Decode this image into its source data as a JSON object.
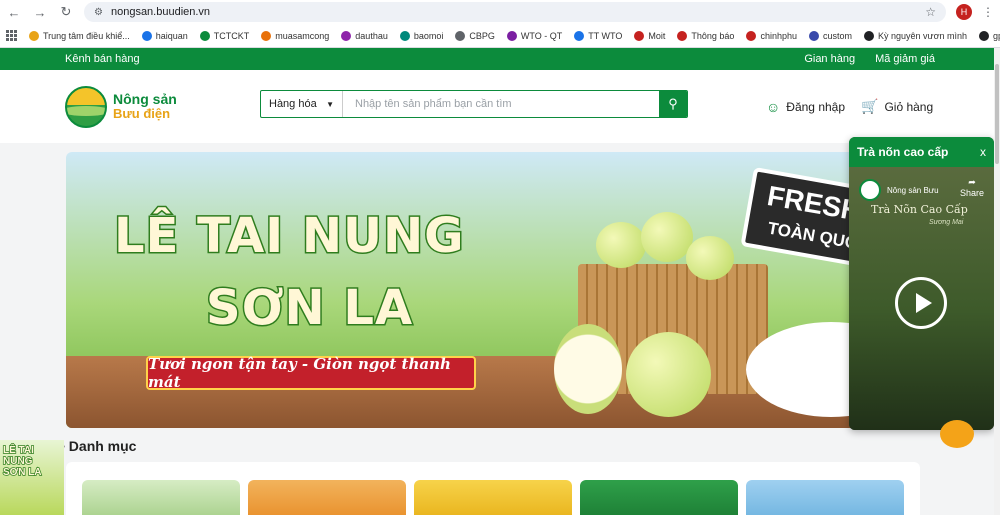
{
  "browser": {
    "url": "nongsan.buudien.vn",
    "profile_initial": "H"
  },
  "bookmarks": [
    {
      "label": "Trung tâm điều khiể...",
      "color": "#e8a317"
    },
    {
      "label": "haiquan",
      "color": "#1a73e8"
    },
    {
      "label": "TCTCKT",
      "color": "#0c8b3c"
    },
    {
      "label": "muasamcong",
      "color": "#e8710a"
    },
    {
      "label": "dauthau",
      "color": "#8e24aa"
    },
    {
      "label": "baomoi",
      "color": "#00897b"
    },
    {
      "label": "CBPG",
      "color": "#5f6368"
    },
    {
      "label": "WTO - QT",
      "color": "#7b1fa2"
    },
    {
      "label": "TT WTO",
      "color": "#1a73e8"
    },
    {
      "label": "Moit",
      "color": "#c5221f"
    },
    {
      "label": "Thông báo",
      "color": "#c5221f"
    },
    {
      "label": "chinhphu",
      "color": "#c5221f"
    },
    {
      "label": "custom",
      "color": "#3949ab"
    },
    {
      "label": "Kỳ nguyên vươn mình",
      "color": "#202124"
    },
    {
      "label": "gpt",
      "color": "#202124"
    }
  ],
  "topbar": {
    "left": "Kênh bán hàng",
    "right": [
      "Gian hàng",
      "Mã giảm giá"
    ]
  },
  "header": {
    "logo_line1": "Nông sản",
    "logo_line2": "Bưu điện",
    "search_category": "Hàng hóa",
    "search_placeholder": "Nhập tên sản phẩm bạn cần tìm",
    "login": "Đăng nhập",
    "cart": "Giỏ hàng"
  },
  "banner": {
    "title1": "LÊ TAI NUNG",
    "title2": "SƠN LA",
    "ribbon": "Tươi ngon tận tay - Giòn ngọt thanh mát",
    "fresh1": "FRESH",
    "fresh2": "TOÀN QUỐC"
  },
  "section": {
    "title": "Danh mục"
  },
  "mini_promo": {
    "line1": "LÊ TAI NUNG",
    "line2": "SƠN LA"
  },
  "popup": {
    "title": "Trà nõn cao cấp",
    "close": "x",
    "channel": "Nông sản Bưu",
    "share": "Share",
    "video_title": "Trà Nõn Cao Cấp",
    "video_subtitle": "Sương Mai"
  },
  "colors": {
    "brand_green": "#0c8b3c",
    "accent_red": "#c3202b",
    "accent_yellow": "#e8a317"
  }
}
